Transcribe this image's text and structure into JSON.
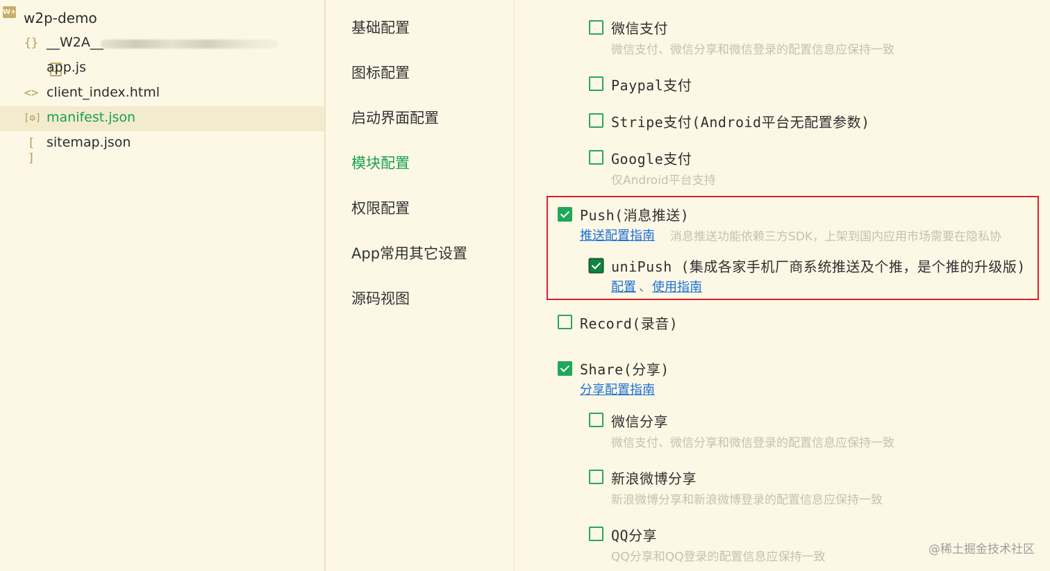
{
  "file_tree": {
    "root": {
      "label": "w2p-demo",
      "icon": "project-icon"
    },
    "items": [
      {
        "icon_glyph": "{}",
        "icon_name": "braces-icon",
        "label": "__W2A__",
        "selected": false
      },
      {
        "icon_glyph": "",
        "icon_name": "js-file-icon",
        "label": "app.js",
        "selected": false
      },
      {
        "icon_glyph": "<>",
        "icon_name": "html-tag-icon",
        "label": "client_index.html",
        "selected": false
      },
      {
        "icon_glyph": "[⚙]",
        "icon_name": "gear-file-icon",
        "label": "manifest.json",
        "selected": true
      },
      {
        "icon_glyph": "[ ]",
        "icon_name": "brackets-icon",
        "label": "sitemap.json",
        "selected": false
      }
    ]
  },
  "config_nav": {
    "items": [
      {
        "label": "基础配置",
        "active": false
      },
      {
        "label": "图标配置",
        "active": false
      },
      {
        "label": "启动界面配置",
        "active": false
      },
      {
        "label": "模块配置",
        "active": true
      },
      {
        "label": "权限配置",
        "active": false
      },
      {
        "label": "App常用其它设置",
        "active": false
      },
      {
        "label": "源码视图",
        "active": false
      }
    ]
  },
  "modules": {
    "wechat_pay": {
      "label": "微信支付",
      "desc": "微信支付、微信分享和微信登录的配置信息应保持一致",
      "checked": false
    },
    "paypal_pay": {
      "label": "Paypal支付",
      "checked": false
    },
    "stripe_pay": {
      "label": "Stripe支付(Android平台无配置参数)",
      "checked": false
    },
    "google_pay": {
      "label": "Google支付",
      "desc": "仅Android平台支持",
      "checked": false
    },
    "push": {
      "label": "Push(消息推送)",
      "link": "推送配置指南",
      "desc": "消息推送功能依赖三方SDK，上架到国内应用市场需要在隐私协",
      "checked": true
    },
    "unipush": {
      "label": "uniPush (集成各家手机厂商系统推送及个推，是个推的升级版)",
      "link_config": "配置",
      "separator": "、",
      "link_guide": "使用指南",
      "checked": true
    },
    "record": {
      "label": "Record(录音)",
      "checked": false
    },
    "share": {
      "label": "Share(分享)",
      "link": "分享配置指南",
      "checked": true
    },
    "wechat_share": {
      "label": "微信分享",
      "desc": "微信支付、微信分享和微信登录的配置信息应保持一致",
      "checked": false
    },
    "weibo_share": {
      "label": "新浪微博分享",
      "desc": "新浪微博分享和新浪微博登录的配置信息应保持一致",
      "checked": false
    },
    "qq_share": {
      "label": "QQ分享",
      "desc": "QQ分享和QQ登录的配置信息应保持一致",
      "checked": false
    }
  },
  "watermark": "@稀土掘金技术社区",
  "colors": {
    "background": "#fdf8e6",
    "accent_green": "#18a04e",
    "checkbox_green": "#1fa85a",
    "link_blue": "#1a6fd6",
    "highlight_red": "#e0202a"
  }
}
